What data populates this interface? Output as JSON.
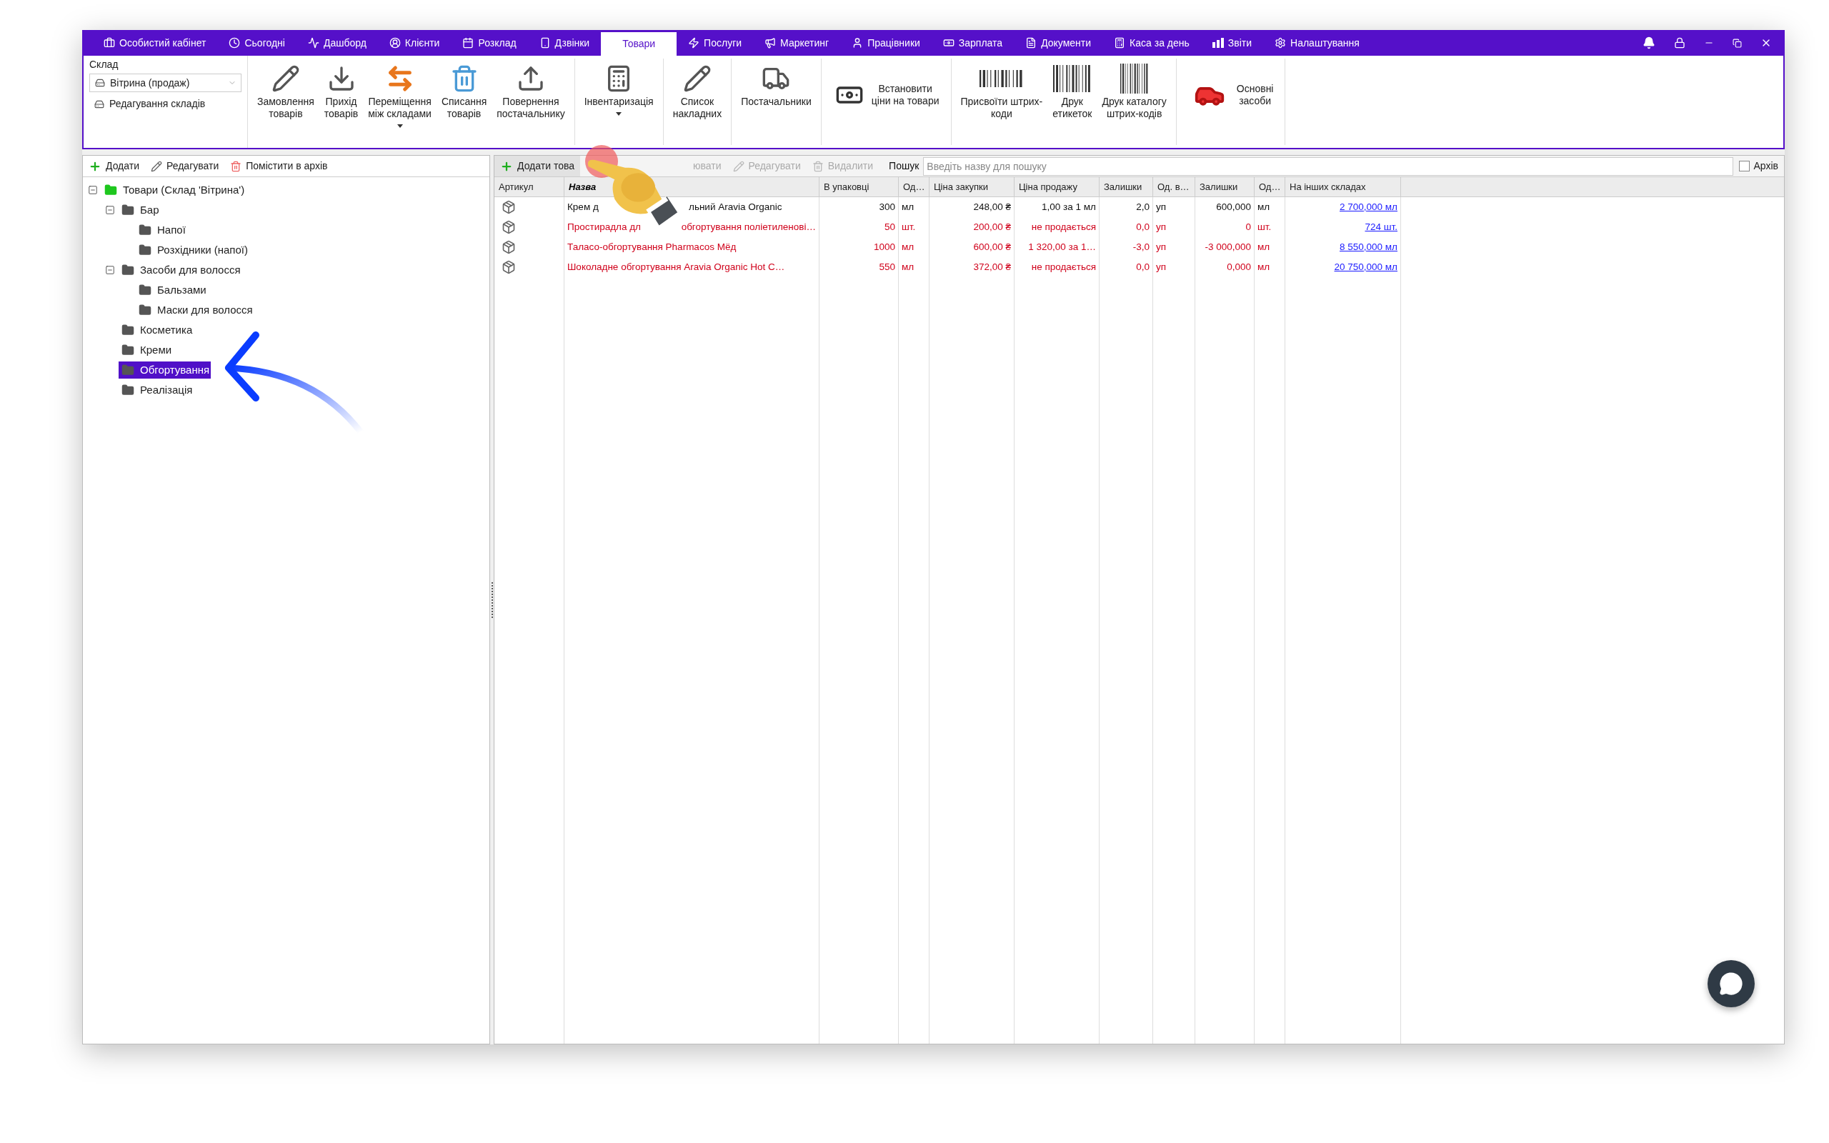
{
  "nav": {
    "items": [
      {
        "label": "Особистий кабінет",
        "selected": false
      },
      {
        "label": "Сьогодні",
        "selected": false
      },
      {
        "label": "Дашборд",
        "selected": false
      },
      {
        "label": "Клієнти",
        "selected": false
      },
      {
        "label": "Розклад",
        "selected": false
      },
      {
        "label": "Дзвінки",
        "selected": false
      },
      {
        "label": "Товари",
        "selected": true
      },
      {
        "label": "Послуги",
        "selected": false
      },
      {
        "label": "Маркетинг",
        "selected": false
      },
      {
        "label": "Працівники",
        "selected": false
      },
      {
        "label": "Зарплата",
        "selected": false
      },
      {
        "label": "Документи",
        "selected": false
      },
      {
        "label": "Каса за день",
        "selected": false
      },
      {
        "label": "Звіти",
        "selected": false
      },
      {
        "label": "Налаштування",
        "selected": false
      }
    ]
  },
  "warehouse": {
    "label": "Склад",
    "value": "Вітрина (продаж)",
    "edit_link": "Редагування складів"
  },
  "toolbar": {
    "groups": [
      [
        {
          "label": "Замовлення\nтоварів",
          "kind": "tall",
          "dropdown": false
        },
        {
          "label": "Прихід\nтоварів",
          "kind": "tall",
          "dropdown": false
        },
        {
          "label": "Переміщення\nміж складами",
          "kind": "tall",
          "dropdown": true
        },
        {
          "label": "Списання\nтоварів",
          "kind": "tall",
          "dropdown": false
        },
        {
          "label": "Повернення\nпостачальнику",
          "kind": "tall",
          "dropdown": false
        }
      ],
      [
        {
          "label": "Інвентаризація",
          "kind": "tall",
          "dropdown": true
        }
      ],
      [
        {
          "label": "Список\nнакладних",
          "kind": "tall",
          "dropdown": false
        }
      ],
      [
        {
          "label": "Постачальники",
          "kind": "tall",
          "dropdown": false
        }
      ],
      [
        {
          "label": "Встановити\nціни на товари",
          "kind": "inline",
          "dropdown": false
        }
      ],
      [
        {
          "label": "Присвоїти штрих-\nкоди",
          "kind": "tall",
          "dropdown": false
        },
        {
          "label": "Друк\nетикеток",
          "kind": "tall",
          "dropdown": false
        },
        {
          "label": "Друк каталогу\nштрих-кодів",
          "kind": "tall",
          "dropdown": false
        }
      ],
      [
        {
          "label": "Основні\nзасоби",
          "kind": "inline",
          "dropdown": false
        }
      ]
    ]
  },
  "tree_toolbar": [
    "Додати",
    "Редагувати",
    "Помістити в архів"
  ],
  "tree": [
    {
      "label": "Товари (Склад 'Вітрина')",
      "kind": "root",
      "expanded": true,
      "selected": false,
      "children": [
        {
          "label": "Бар",
          "kind": "folder",
          "expanded": true,
          "selected": false,
          "children": [
            {
              "label": "Напої",
              "kind": "folder",
              "selected": false
            },
            {
              "label": "Розхідники (напої)",
              "kind": "folder",
              "selected": false
            }
          ]
        },
        {
          "label": "Засоби для волосся",
          "kind": "folder",
          "expanded": true,
          "selected": false,
          "children": [
            {
              "label": "Бальзами",
              "kind": "folder",
              "selected": false
            },
            {
              "label": "Маски для волосся",
              "kind": "folder",
              "selected": false
            }
          ]
        },
        {
          "label": "Косметика",
          "kind": "folder",
          "selected": false
        },
        {
          "label": "Креми",
          "kind": "folder",
          "selected": false
        },
        {
          "label": "Обгортування",
          "kind": "folder",
          "selected": true
        },
        {
          "label": "Реалізація",
          "kind": "folder",
          "selected": false
        }
      ]
    }
  ],
  "table_toolbar": {
    "buttons": [
      {
        "label": "Додати това",
        "disabled": false
      },
      {
        "label": "ювати",
        "disabled": true
      },
      {
        "label": "Редагувати",
        "disabled": true
      },
      {
        "label": "Видалити",
        "disabled": true
      }
    ],
    "search": {
      "label": "Пошук",
      "placeholder": "Введіть назву для пошуку"
    },
    "archive": {
      "label": "Архів",
      "checked": false
    }
  },
  "table": {
    "columns": [
      {
        "title": "Артикул",
        "sorted": false
      },
      {
        "title": "Назва",
        "sorted": true
      },
      {
        "title": "В упаковці",
        "sorted": false
      },
      {
        "title": "Од…",
        "sorted": false
      },
      {
        "title": "Ціна закупки",
        "sorted": false
      },
      {
        "title": "Ціна продажу",
        "sorted": false
      },
      {
        "title": "Залишки",
        "sorted": false
      },
      {
        "title": "Од. в…",
        "sorted": false
      },
      {
        "title": "Залишки",
        "sorted": false
      },
      {
        "title": "Од…",
        "sorted": false
      },
      {
        "title": "На інших складах",
        "sorted": false
      }
    ],
    "rows": [
      {
        "alert": false,
        "cells": [
          "",
          "Крем д",
          "300",
          "мл",
          "248,00 ₴",
          "1,00 за 1 мл",
          "2,0",
          "уп",
          "600,000",
          "мл",
          "2 700,000 мл"
        ],
        "name_rest": "льний Aravia Organic"
      },
      {
        "alert": true,
        "cells": [
          "",
          "Простирадла дл",
          "50",
          "шт.",
          "200,00 ₴",
          "не продається",
          "0,0",
          "уп",
          "0",
          "шт.",
          "724 шт."
        ],
        "name_rest": "обгортування поліетиленові…"
      },
      {
        "alert": true,
        "cells": [
          "",
          "Таласо-обгортування Pharmacos Мёд",
          "1000",
          "мл",
          "600,00 ₴",
          "1 320,00 за 1…",
          "-3,0",
          "уп",
          "-3 000,000",
          "мл",
          "8 550,000 мл"
        ]
      },
      {
        "alert": true,
        "cells": [
          "",
          "Шоколадне обгортування Aravia Organic Hot C…",
          "550",
          "мл",
          "372,00 ₴",
          "не продається",
          "0,0",
          "уп",
          "0,000",
          "мл",
          "20 750,000 мл"
        ]
      }
    ]
  }
}
